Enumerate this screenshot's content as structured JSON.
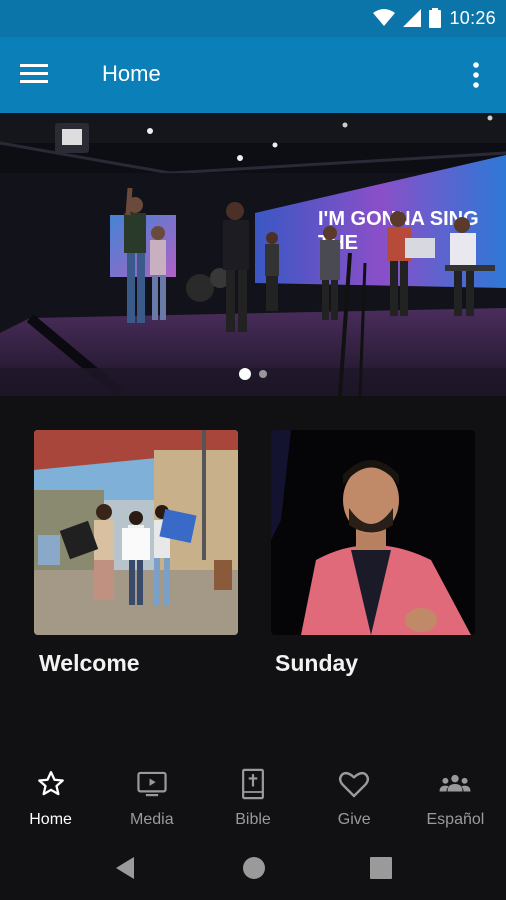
{
  "status": {
    "time": "10:26",
    "icons": [
      "wifi-icon",
      "signal-icon",
      "battery-icon"
    ]
  },
  "appbar": {
    "title": "Home",
    "menu_icon": "menu-icon",
    "more_icon": "more-vert-icon",
    "color": "#0b7fb8"
  },
  "hero": {
    "slide_count": 2,
    "active_slide": 1,
    "screen_text": [
      "I'M GONNA SING",
      "THE"
    ]
  },
  "cards": [
    {
      "title": "Welcome"
    },
    {
      "title": "Sunday"
    }
  ],
  "bottom_nav": [
    {
      "label": "Home",
      "icon": "star-icon",
      "active": true
    },
    {
      "label": "Media",
      "icon": "tv-icon",
      "active": false
    },
    {
      "label": "Bible",
      "icon": "bible-icon",
      "active": false
    },
    {
      "label": "Give",
      "icon": "heart-icon",
      "active": false
    },
    {
      "label": "Español",
      "icon": "group-icon",
      "active": false
    }
  ],
  "system_nav": [
    "back-icon",
    "home-circle-icon",
    "recents-icon"
  ]
}
